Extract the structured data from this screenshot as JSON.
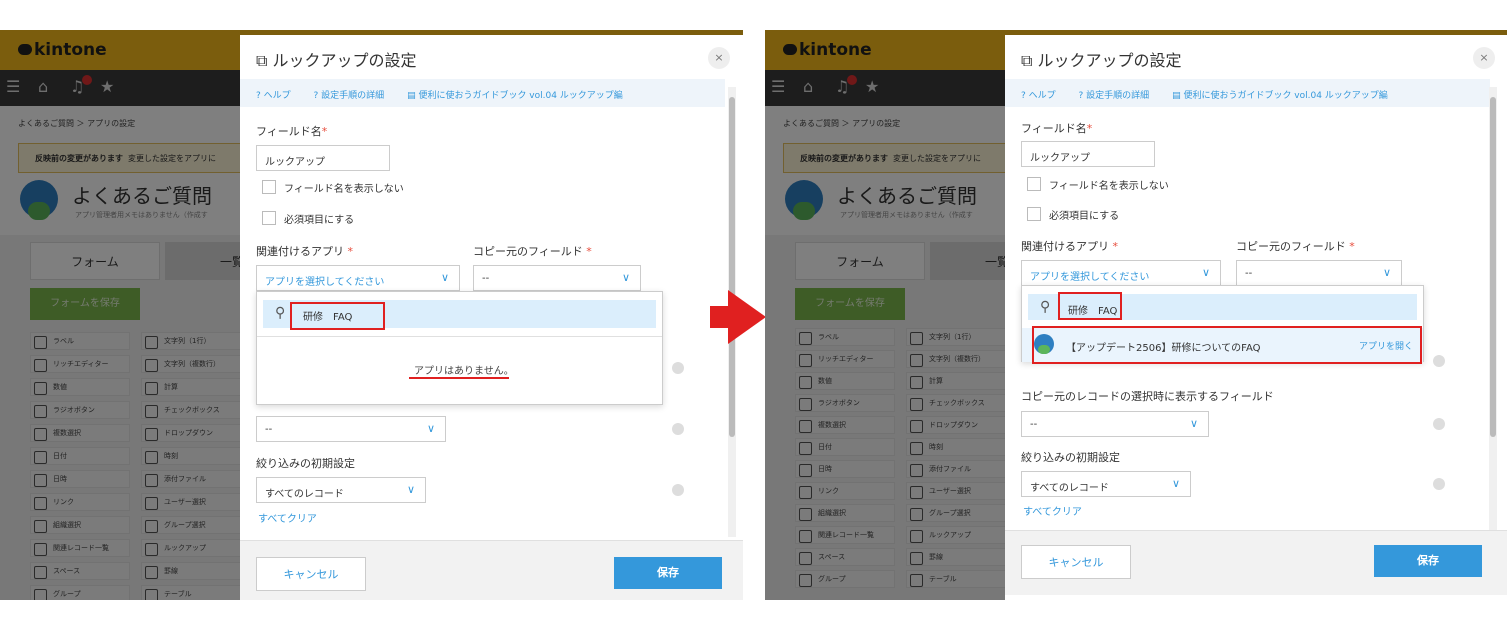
{
  "app": {
    "logo": "kintone",
    "breadcrumb": "よくあるご質問 ＞ アプリの設定",
    "notice_bold": "反映前の変更があります",
    "notice_rest": "変更した設定をアプリに",
    "app_title": "よくあるご質問",
    "app_memo": "アプリ管理者用メモはありません（作成す",
    "tab_form": "フォーム",
    "tab_list": "一覧",
    "save_form": "フォームを保存",
    "palette": [
      "ラベル",
      "文字列（1行）",
      "リッチエディター",
      "文字列（複数行）",
      "数値",
      "計算",
      "ラジオボタン",
      "チェックボックス",
      "複数選択",
      "ドロップダウン",
      "日付",
      "時刻",
      "日時",
      "添付ファイル",
      "リンク",
      "ユーザー選択",
      "組織選択",
      "グループ選択",
      "関連レコード一覧",
      "ルックアップ",
      "スペース",
      "罫線",
      "グループ",
      "テーブル"
    ]
  },
  "dialog": {
    "title": "ルックアップの設定",
    "close": "×",
    "help": "ヘルプ",
    "steps": "設定手順の詳細",
    "guide": "便利に使おうガイドブック vol.04 ルックアップ編",
    "field_name_label": "フィールド名",
    "field_name_value": "ルックアップ",
    "hide_name": "フィールド名を表示しない",
    "required": "必須項目にする",
    "related_app_label": "関連付けるアプリ",
    "copy_from_label": "コピー元のフィールド",
    "select_app_placeholder": "アプリを選択してください",
    "copy_from_value": "--",
    "search_query": "研修　FAQ",
    "no_apps": "アプリはありません。",
    "result_app": "【アップデート2506】研修についてのFAQ",
    "open_app": "アプリを開く",
    "display_fields_label": "コピー元のレコードの選択時に表示するフィールド",
    "display_fields_value": "--",
    "filter_label": "絞り込みの初期設定",
    "filter_value": "すべてのレコード",
    "clear_all": "すべてクリア",
    "cancel": "キャンセル",
    "save": "保存"
  },
  "colors": {
    "accent": "#3498db",
    "highlight": "#e02020",
    "header": "#f6bb1a"
  }
}
